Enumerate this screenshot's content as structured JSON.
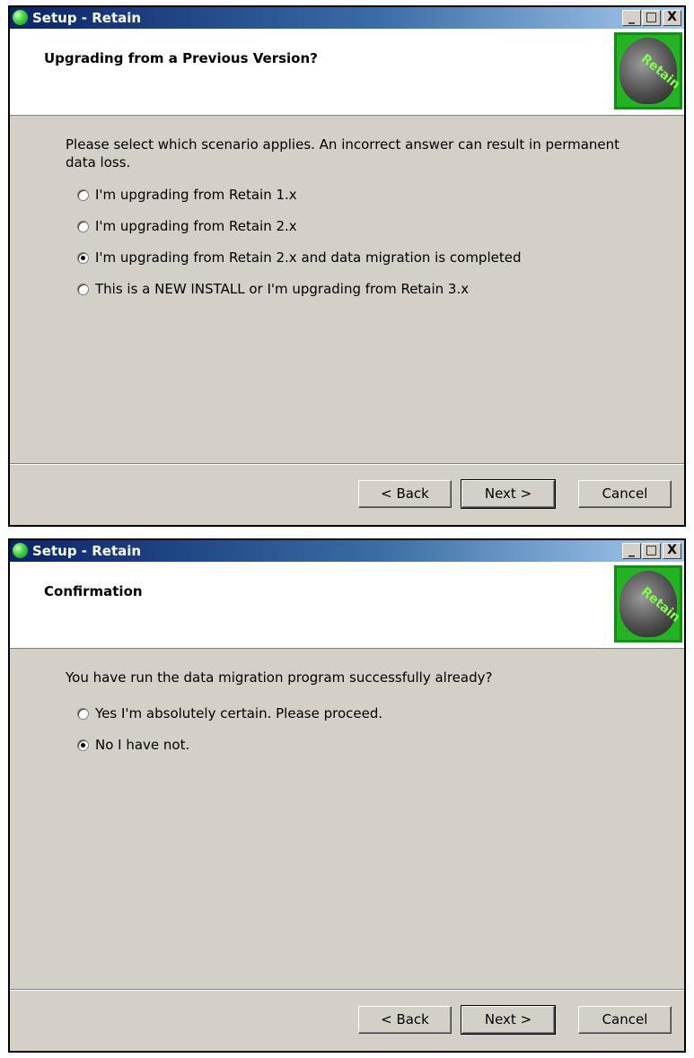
{
  "window1": {
    "title": "Setup - Retain",
    "header_title": "Upgrading from a Previous Version?",
    "logo_text": "Retain",
    "prompt": "Please select which scenario applies. An incorrect answer can result in permanent data loss.",
    "options": [
      {
        "label": "I'm upgrading from Retain 1.x",
        "selected": false
      },
      {
        "label": "I'm upgrading from Retain 2.x",
        "selected": false
      },
      {
        "label": "I'm upgrading from Retain 2.x and data migration is completed",
        "selected": true
      },
      {
        "label": "This is a NEW INSTALL or I'm upgrading from Retain 3.x",
        "selected": false
      }
    ],
    "buttons": {
      "back": "< Back",
      "next": "Next >",
      "cancel": "Cancel"
    }
  },
  "window2": {
    "title": "Setup - Retain",
    "header_title": "Confirmation",
    "logo_text": "Retain",
    "prompt": "You have run the data migration program successfully already?",
    "options": [
      {
        "label": "Yes I'm absolutely certain. Please proceed.",
        "selected": false
      },
      {
        "label": "No I have not.",
        "selected": true
      }
    ],
    "buttons": {
      "back": "< Back",
      "next": "Next >",
      "cancel": "Cancel"
    }
  },
  "titlebar_buttons": {
    "minimize": "_",
    "maximize": "□",
    "close": "X"
  },
  "colors": {
    "titlebar_start": "#0a246a",
    "titlebar_end": "#a6caf0",
    "dialog_bg": "#d4d0c8",
    "logo_green": "#22b422"
  }
}
